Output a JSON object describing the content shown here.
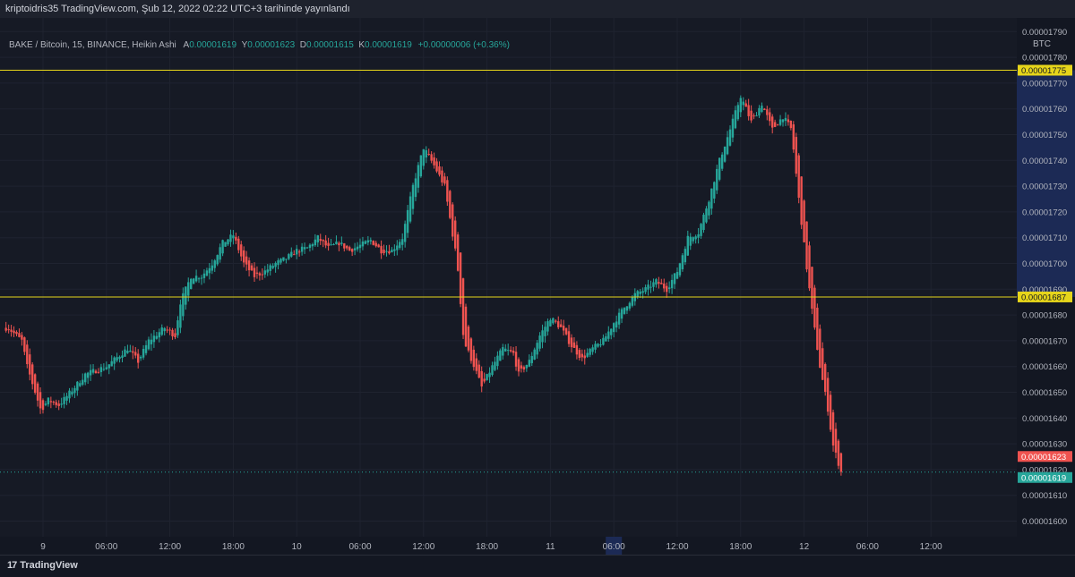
{
  "publish_line": "kriptoidris35 TradingView.com, Şub 12, 2022 02:22 UTC+3 tarihinde yayınlandı",
  "legend": {
    "symbol": "BAKE / Bitcoin, 15, BINANCE, Heikin Ashi",
    "o_label": "A",
    "o": "0.00001619",
    "h_label": "Y",
    "h": "0.00001623",
    "l_label": "D",
    "l": "0.00001615",
    "c_label": "K",
    "c": "0.00001619",
    "change": "+0.00000006 (+0.36%)"
  },
  "currency": "BTC",
  "footer": {
    "brand": "TradingView",
    "logo_mark": "17"
  },
  "colors": {
    "up": "#26a69a",
    "down": "#ef5350",
    "hline": "#e6d51a",
    "bg": "#161a25",
    "axis_bg": "#131722",
    "highlight": "#1c2a55"
  },
  "chart_data": {
    "type": "candlestick",
    "chart_style": "Heikin Ashi",
    "ylim": [
      1.595e-05,
      1.795e-05
    ],
    "y_ticks": [
      "0.00001600",
      "0.00001610",
      "0.00001620",
      "0.00001630",
      "0.00001640",
      "0.00001650",
      "0.00001660",
      "0.00001670",
      "0.00001680",
      "0.00001690",
      "0.00001700",
      "0.00001710",
      "0.00001720",
      "0.00001730",
      "0.00001740",
      "0.00001750",
      "0.00001760",
      "0.00001770",
      "0.00001780",
      "0.00001790"
    ],
    "y_tick_values": [
      1600,
      1610,
      1620,
      1630,
      1640,
      1650,
      1660,
      1670,
      1680,
      1690,
      1700,
      1710,
      1720,
      1730,
      1740,
      1750,
      1760,
      1770,
      1780,
      1790
    ],
    "y_tick_prefix": "0.0000",
    "x_ticks": [
      {
        "label": "9",
        "t": 0
      },
      {
        "label": "06:00",
        "t": 6
      },
      {
        "label": "12:00",
        "t": 12
      },
      {
        "label": "18:00",
        "t": 18
      },
      {
        "label": "10",
        "t": 24
      },
      {
        "label": "06:00",
        "t": 30
      },
      {
        "label": "12:00",
        "t": 36
      },
      {
        "label": "18:00",
        "t": 42
      },
      {
        "label": "11",
        "t": 48
      },
      {
        "label": "06:00",
        "t": 54,
        "highlight": true
      },
      {
        "label": "12:00",
        "t": 60
      },
      {
        "label": "18:00",
        "t": 66
      },
      {
        "label": "12",
        "t": 72
      },
      {
        "label": "06:00",
        "t": 78
      },
      {
        "label": "12:00",
        "t": 84
      }
    ],
    "x_unit": "hours since Feb 9 00:00",
    "horizontal_lines": [
      {
        "label": "0.00001775",
        "value": 1775
      },
      {
        "label": "0.00001687",
        "value": 1687
      }
    ],
    "last_price_labels": [
      {
        "label": "0.00001623",
        "value": 1623,
        "color": "#ef5350"
      },
      {
        "label": "0.00001619",
        "value": 1619,
        "color": "#26a69a"
      }
    ],
    "price_keypoints": [
      [
        -3.3,
        1675
      ],
      [
        -2,
        1670
      ],
      [
        -1.5,
        1660
      ],
      [
        -0.2,
        1643
      ],
      [
        0.5,
        1647
      ],
      [
        1.5,
        1645
      ],
      [
        3,
        1652
      ],
      [
        4,
        1657
      ],
      [
        6,
        1660
      ],
      [
        8,
        1667
      ],
      [
        9,
        1662
      ],
      [
        10,
        1670
      ],
      [
        11.5,
        1675
      ],
      [
        12.5,
        1672
      ],
      [
        13,
        1685
      ],
      [
        14,
        1695
      ],
      [
        15,
        1695
      ],
      [
        16,
        1700
      ],
      [
        17,
        1708
      ],
      [
        18,
        1711
      ],
      [
        19,
        1700
      ],
      [
        20,
        1695
      ],
      [
        21,
        1697
      ],
      [
        22,
        1700
      ],
      [
        23,
        1702
      ],
      [
        24,
        1705
      ],
      [
        25,
        1706
      ],
      [
        26,
        1710
      ],
      [
        27,
        1706
      ],
      [
        28,
        1708
      ],
      [
        29,
        1705
      ],
      [
        30,
        1707
      ],
      [
        31,
        1709
      ],
      [
        32,
        1705
      ],
      [
        33,
        1705
      ],
      [
        34,
        1710
      ],
      [
        35,
        1730
      ],
      [
        36,
        1745
      ],
      [
        37,
        1738
      ],
      [
        38,
        1730
      ],
      [
        38.6,
        1715
      ],
      [
        39.2,
        1700
      ],
      [
        39.8,
        1670
      ],
      [
        40.8,
        1660
      ],
      [
        41.5,
        1652
      ],
      [
        42.5,
        1660
      ],
      [
        43.5,
        1667
      ],
      [
        44.5,
        1665
      ],
      [
        45,
        1657
      ],
      [
        46,
        1662
      ],
      [
        47,
        1672
      ],
      [
        48,
        1679
      ],
      [
        49,
        1675
      ],
      [
        50,
        1668
      ],
      [
        51,
        1663
      ],
      [
        52,
        1667
      ],
      [
        53,
        1670
      ],
      [
        54,
        1677
      ],
      [
        55,
        1683
      ],
      [
        56,
        1688
      ],
      [
        57,
        1690
      ],
      [
        58,
        1693
      ],
      [
        59,
        1690
      ],
      [
        60,
        1697
      ],
      [
        61,
        1710
      ],
      [
        62,
        1712
      ],
      [
        63,
        1725
      ],
      [
        64,
        1740
      ],
      [
        65,
        1752
      ],
      [
        66,
        1765
      ],
      [
        67,
        1755
      ],
      [
        68,
        1762
      ],
      [
        69,
        1752
      ],
      [
        70,
        1757
      ],
      [
        70.8,
        1752
      ],
      [
        71.5,
        1725
      ],
      [
        72.2,
        1700
      ],
      [
        72.8,
        1680
      ],
      [
        73.5,
        1660
      ],
      [
        74.2,
        1645
      ],
      [
        74.7,
        1630
      ],
      [
        75.5,
        1619
      ]
    ],
    "price_range_hours": [
      -3.5,
      75.5
    ],
    "bars_per_hour": 4
  }
}
